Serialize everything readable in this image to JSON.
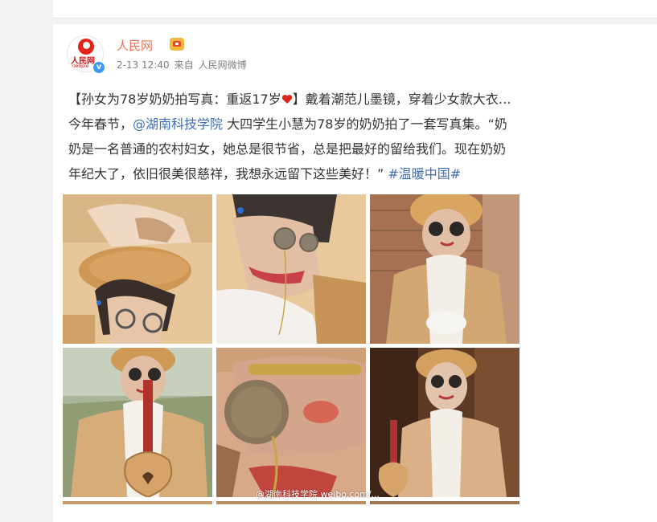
{
  "post": {
    "author": "人民网",
    "avatar_text": "人民网",
    "avatar_sub": "people",
    "verified_badge": "v",
    "time": "2-13 12:40",
    "source_prefix": "来自",
    "source": "人民网微博",
    "text_lines": [
      {
        "segments": [
          {
            "text": "【孙女为78岁奶奶拍写真：重返17岁",
            "type": "text"
          },
          {
            "text": "",
            "type": "heart"
          },
          {
            "text": "】戴着潮范儿墨镜，穿着少女款大衣…",
            "type": "text"
          }
        ]
      },
      {
        "segments": [
          {
            "text": "今年春节，",
            "type": "text"
          },
          {
            "text": "@湖南科技学院",
            "type": "link"
          },
          {
            "text": " 大四学生小慧为78岁的奶奶拍了一套写真集。“奶",
            "type": "text"
          }
        ]
      },
      {
        "segments": [
          {
            "text": "奶是一名普通的农村妇女，她总是很节省，总是把最好的留给我们。现在奶奶",
            "type": "text"
          }
        ]
      },
      {
        "segments": [
          {
            "text": "年纪大了，依旧很美很慈祥，我想永远留下这些美好！”",
            "type": "text"
          },
          {
            "text": " ",
            "type": "text"
          },
          {
            "text": "#温暖中国#",
            "type": "link"
          }
        ]
      }
    ],
    "watermark": "@湖南科技学院 weibo.com/..."
  },
  "photos": [
    {
      "name": "photo-hands-beret",
      "caption": ""
    },
    {
      "name": "photo-closeup-sunglasses",
      "caption": ""
    },
    {
      "name": "photo-brick-wall-coat",
      "caption": ""
    },
    {
      "name": "photo-ukulele-outdoor",
      "caption": ""
    },
    {
      "name": "photo-extreme-closeup-glasses",
      "caption": ""
    },
    {
      "name": "photo-ukulele-doorway",
      "caption": ""
    }
  ],
  "colors": {
    "author": "#eb7350",
    "link": "#3f6db8",
    "text": "#333333",
    "meta": "#808080",
    "heart": "#e2231a"
  }
}
